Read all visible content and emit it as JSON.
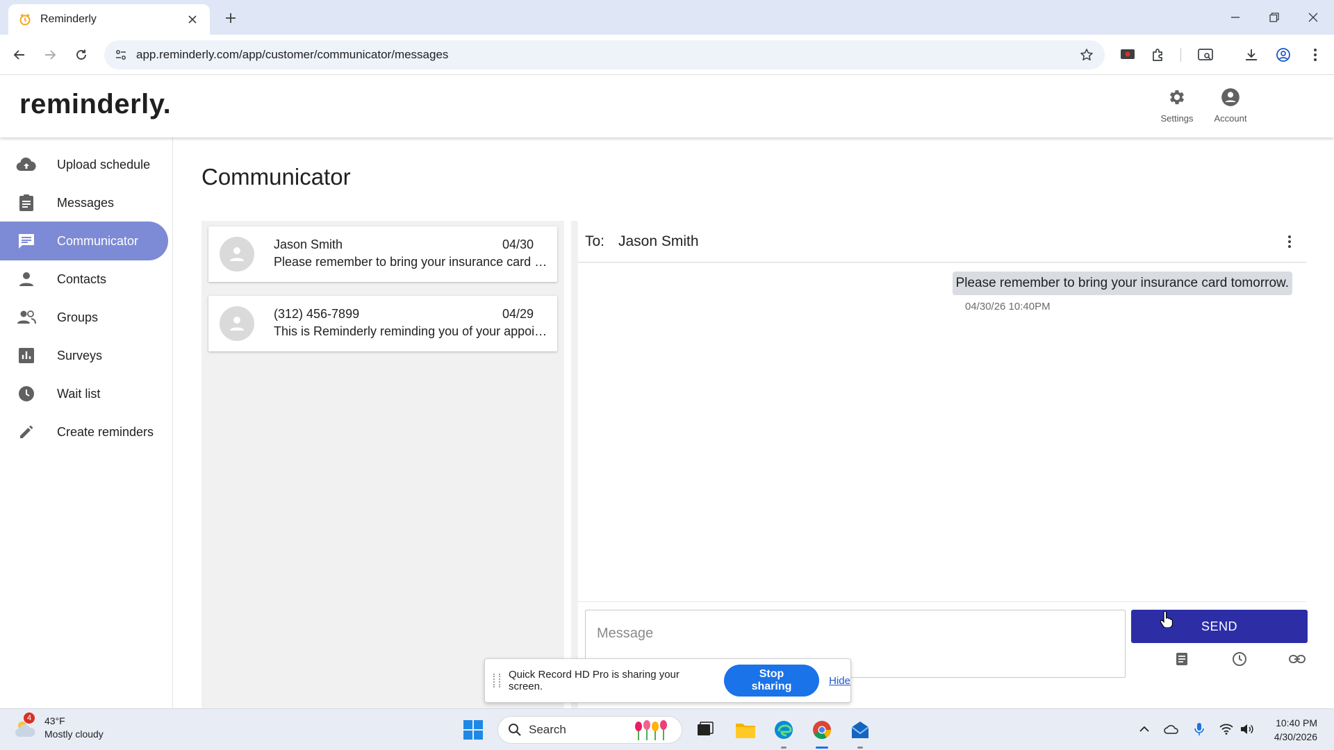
{
  "browser": {
    "tab_title": "Reminderly",
    "url": "app.reminderly.com/app/customer/communicator/messages"
  },
  "app": {
    "logo": "reminderly.",
    "header_buttons": {
      "settings": "Settings",
      "account": "Account"
    }
  },
  "sidebar": {
    "items": [
      {
        "label": "Upload schedule",
        "icon": "cloud-upload-icon"
      },
      {
        "label": "Messages",
        "icon": "clipboard-icon"
      },
      {
        "label": "Communicator",
        "icon": "chat-icon",
        "active": true
      },
      {
        "label": "Contacts",
        "icon": "person-icon"
      },
      {
        "label": "Groups",
        "icon": "people-icon"
      },
      {
        "label": "Surveys",
        "icon": "bar-chart-icon"
      },
      {
        "label": "Wait list",
        "icon": "clock-icon"
      },
      {
        "label": "Create reminders",
        "icon": "pencil-icon"
      }
    ],
    "active_color": "#7d8ad6"
  },
  "main": {
    "title": "Communicator",
    "conversations": [
      {
        "name": "Jason Smith",
        "date": "04/30",
        "preview": "Please remember to bring your insurance card tomorrow."
      },
      {
        "name": "(312) 456-7899",
        "date": "04/29",
        "preview": "This is Reminderly reminding you of your appointment."
      }
    ],
    "chat": {
      "to_label": "To:",
      "to_name": "Jason Smith",
      "messages": [
        {
          "text": "Please remember to bring your insurance card tomorrow.",
          "time": "04/30/26 10:40PM"
        }
      ],
      "input_placeholder": "Message",
      "send_label": "SEND"
    },
    "send_color": "#2d2ea6"
  },
  "share_bar": {
    "text": "Quick Record HD Pro is sharing your screen.",
    "stop_label": "Stop sharing",
    "hide_label": "Hide"
  },
  "taskbar": {
    "weather_badge": "4",
    "temperature": "43°F",
    "weather_desc": "Mostly cloudy",
    "search_label": "Search",
    "time": "10:40 PM",
    "date": "4/30/2026"
  }
}
